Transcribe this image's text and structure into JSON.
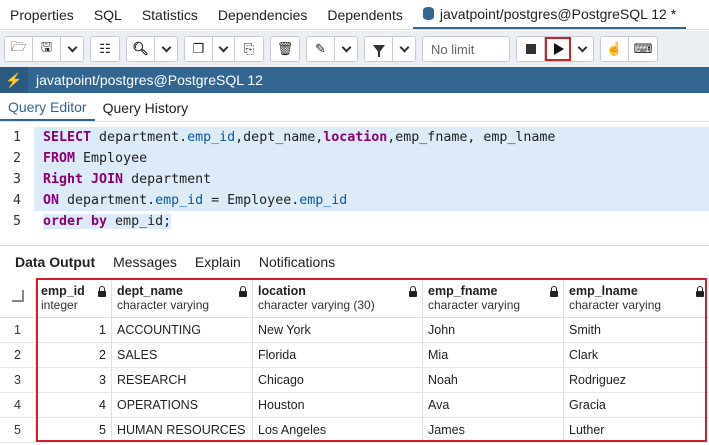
{
  "top_tabs": [
    "Properties",
    "SQL",
    "Statistics",
    "Dependencies",
    "Dependents"
  ],
  "active_tab": "javatpoint/postgres@PostgreSQL 12 *",
  "toolbar": {
    "limit_label": "No limit"
  },
  "connection": {
    "title": "javatpoint/postgres@PostgreSQL 12"
  },
  "editor_tabs": [
    "Query Editor",
    "Query History"
  ],
  "editor": {
    "line_numbers": [
      "1",
      "2",
      "3",
      "4",
      "5"
    ],
    "lines": [
      [
        {
          "t": "SELECT",
          "c": "kw"
        },
        {
          "t": " department.",
          "c": ""
        },
        {
          "t": "emp_id",
          "c": "fld"
        },
        {
          "t": ",dept_name,",
          "c": ""
        },
        {
          "t": "location",
          "c": "kw"
        },
        {
          "t": ",emp_fname, emp_lname",
          "c": ""
        }
      ],
      [
        {
          "t": "FROM",
          "c": "kw"
        },
        {
          "t": " Employee",
          "c": ""
        }
      ],
      [
        {
          "t": "Right JOIN",
          "c": "kw"
        },
        {
          "t": " department",
          "c": ""
        }
      ],
      [
        {
          "t": "ON",
          "c": "kw"
        },
        {
          "t": " department.",
          "c": ""
        },
        {
          "t": "emp_id",
          "c": "fld"
        },
        {
          "t": " = Employee.",
          "c": ""
        },
        {
          "t": "emp_id",
          "c": "fld"
        }
      ],
      [
        {
          "t": "order by",
          "c": "kw"
        },
        {
          "t": " emp_id;",
          "c": ""
        }
      ]
    ]
  },
  "result_tabs": [
    "Data Output",
    "Messages",
    "Explain",
    "Notifications"
  ],
  "grid": {
    "columns": [
      {
        "name": "emp_id",
        "type": "integer"
      },
      {
        "name": "dept_name",
        "type": "character varying"
      },
      {
        "name": "location",
        "type": "character varying (30)"
      },
      {
        "name": "emp_fname",
        "type": "character varying"
      },
      {
        "name": "emp_lname",
        "type": "character varying"
      }
    ],
    "rows": [
      {
        "idx": "1",
        "cells": [
          "1",
          "ACCOUNTING",
          "New York",
          "John",
          "Smith"
        ]
      },
      {
        "idx": "2",
        "cells": [
          "2",
          "SALES",
          "Florida",
          "Mia",
          "Clark"
        ]
      },
      {
        "idx": "3",
        "cells": [
          "3",
          "RESEARCH",
          "Chicago",
          "Noah",
          "Rodriguez"
        ]
      },
      {
        "idx": "4",
        "cells": [
          "4",
          "OPERATIONS",
          "Houston",
          "Ava",
          "Gracia"
        ]
      },
      {
        "idx": "5",
        "cells": [
          "5",
          "HUMAN RESOURCES",
          "Los Angeles",
          "James",
          "Luther"
        ]
      }
    ]
  },
  "colors": {
    "accent": "#326690",
    "highlight": "#d0202a",
    "keyword": "#8b0075",
    "field": "#0b56a6"
  }
}
